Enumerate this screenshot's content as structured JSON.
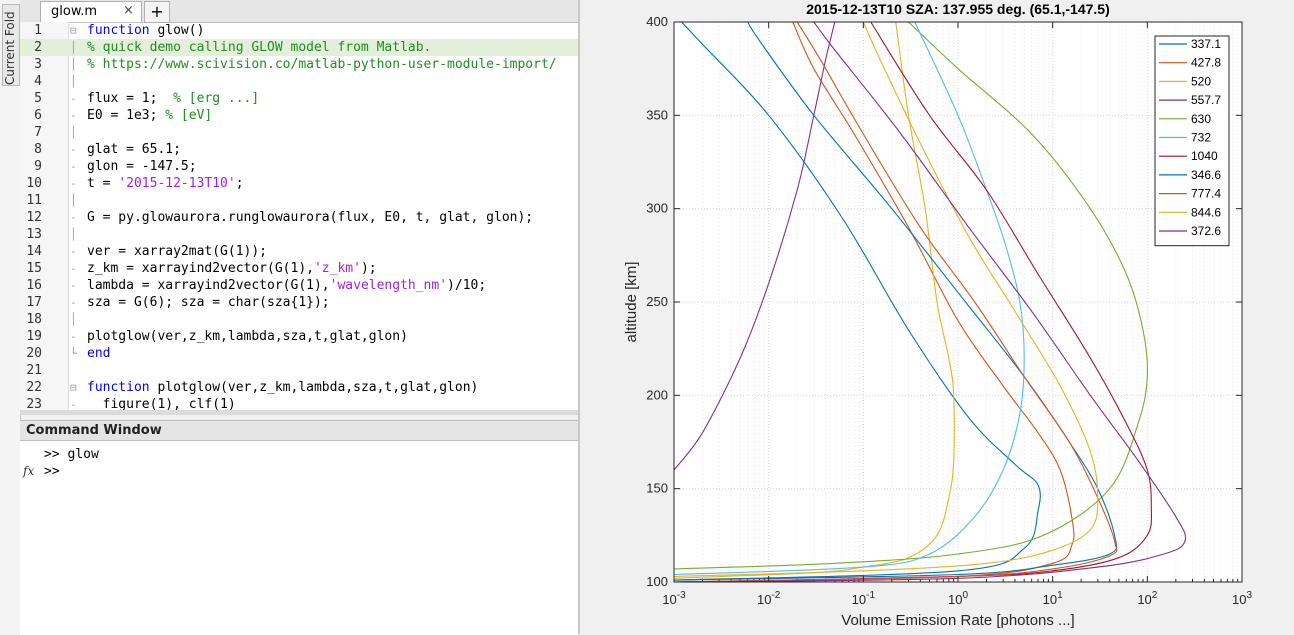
{
  "sidebar": {
    "current_folder_label": "Current Fold"
  },
  "editor": {
    "tabs": [
      {
        "label": "glow.m",
        "close": "×"
      }
    ],
    "add_tab": "+",
    "lines": [
      {
        "n": "1",
        "fold": "⊟",
        "segs": [
          {
            "t": "function",
            "c": "kw"
          },
          {
            "t": " glow()",
            "c": ""
          }
        ]
      },
      {
        "n": "2",
        "fold": "│",
        "hl": true,
        "segs": [
          {
            "t": "% quick demo calling GLOW model from Matlab.",
            "c": "cm"
          }
        ]
      },
      {
        "n": "3",
        "fold": "│",
        "segs": [
          {
            "t": "% https://www.scivision.co/matlab-python-user-module-import/",
            "c": "cm"
          }
        ]
      },
      {
        "n": "4",
        "fold": "│",
        "segs": []
      },
      {
        "n": "5",
        "fold": "-",
        "segs": [
          {
            "t": "flux = 1;  ",
            "c": ""
          },
          {
            "t": "% [erg ...]",
            "c": "cm"
          }
        ]
      },
      {
        "n": "6",
        "fold": "-",
        "segs": [
          {
            "t": "E0 = 1e3; ",
            "c": ""
          },
          {
            "t": "% [eV]",
            "c": "cm"
          }
        ]
      },
      {
        "n": "7",
        "fold": "│",
        "segs": []
      },
      {
        "n": "8",
        "fold": "-",
        "segs": [
          {
            "t": "glat = 65.1;",
            "c": ""
          }
        ]
      },
      {
        "n": "9",
        "fold": "-",
        "segs": [
          {
            "t": "glon = -147.5;",
            "c": ""
          }
        ]
      },
      {
        "n": "10",
        "fold": "-",
        "segs": [
          {
            "t": "t = ",
            "c": ""
          },
          {
            "t": "'2015-12-13T10'",
            "c": "str"
          },
          {
            "t": ";",
            "c": ""
          }
        ]
      },
      {
        "n": "11",
        "fold": "│",
        "segs": []
      },
      {
        "n": "12",
        "fold": "-",
        "segs": [
          {
            "t": "G = py.glowaurora.runglowaurora(flux, E0, t, glat, glon);",
            "c": ""
          }
        ]
      },
      {
        "n": "13",
        "fold": "│",
        "segs": []
      },
      {
        "n": "14",
        "fold": "-",
        "segs": [
          {
            "t": "ver = xarray2mat(G(1));",
            "c": ""
          }
        ]
      },
      {
        "n": "15",
        "fold": "-",
        "segs": [
          {
            "t": "z_km = xarrayind2vector(G(1),",
            "c": ""
          },
          {
            "t": "'z_km'",
            "c": "str"
          },
          {
            "t": ");",
            "c": ""
          }
        ]
      },
      {
        "n": "16",
        "fold": "-",
        "segs": [
          {
            "t": "lambda = xarrayind2vector(G(1),",
            "c": ""
          },
          {
            "t": "'wavelength_nm'",
            "c": "str"
          },
          {
            "t": ")/10;",
            "c": ""
          }
        ]
      },
      {
        "n": "17",
        "fold": "-",
        "segs": [
          {
            "t": "sza = G(6); sza = char(sza{1});",
            "c": ""
          }
        ]
      },
      {
        "n": "18",
        "fold": "│",
        "segs": []
      },
      {
        "n": "19",
        "fold": "-",
        "segs": [
          {
            "t": "plotglow(ver,z_km,lambda,sza,t,glat,glon)",
            "c": ""
          }
        ]
      },
      {
        "n": "20",
        "fold": "└",
        "segs": [
          {
            "t": "end",
            "c": "kw"
          }
        ]
      },
      {
        "n": "21",
        "fold": "",
        "segs": []
      },
      {
        "n": "22",
        "fold": "⊟",
        "segs": [
          {
            "t": "function",
            "c": "kw"
          },
          {
            "t": " plotglow(ver,z_km,lambda,sza,t,glat,glon)",
            "c": ""
          }
        ]
      },
      {
        "n": "23",
        "fold": "-",
        "segs": [
          {
            "t": "  figure(1), clf(1)",
            "c": ""
          }
        ]
      }
    ]
  },
  "command_window": {
    "title": "Command Window",
    "lines": [
      ">> glow",
      ">>"
    ],
    "fx_icon": "fx"
  },
  "chart_data": {
    "type": "line",
    "title": "2015-12-13T10 SZA: 137.955 deg.  (65.1,-147.5)",
    "xlabel": "Volume Emission Rate [photons ...]",
    "ylabel": "altitude [km]",
    "xscale": "log",
    "xlim": [
      0.001,
      1000
    ],
    "ylim": [
      100,
      400
    ],
    "xticks": [
      {
        "base": "10",
        "exp": "-3"
      },
      {
        "base": "10",
        "exp": "-2"
      },
      {
        "base": "10",
        "exp": "-1"
      },
      {
        "base": "10",
        "exp": "0"
      },
      {
        "base": "10",
        "exp": "1"
      },
      {
        "base": "10",
        "exp": "2"
      },
      {
        "base": "10",
        "exp": "3"
      }
    ],
    "yticks": [
      "100",
      "150",
      "200",
      "250",
      "300",
      "350",
      "400"
    ],
    "grid": true,
    "legend_position": "top-right",
    "series": [
      {
        "name": "337.1",
        "color": "#0072bd",
        "points": [
          [
            0.001,
            101
          ],
          [
            1,
            106
          ],
          [
            5,
            118
          ],
          [
            7,
            138
          ],
          [
            7,
            152
          ],
          [
            4,
            163
          ],
          [
            1.3,
            188
          ],
          [
            0.3,
            235
          ],
          [
            0.06,
            295
          ],
          [
            0.01,
            350
          ],
          [
            0.002,
            388
          ],
          [
            0.0012,
            400
          ]
        ]
      },
      {
        "name": "427.8",
        "color": "#d95319",
        "points": [
          [
            0.001,
            100
          ],
          [
            1,
            103
          ],
          [
            10,
            110
          ],
          [
            16,
            120
          ],
          [
            16,
            134
          ],
          [
            12,
            160
          ],
          [
            7,
            180
          ],
          [
            3,
            205
          ],
          [
            1,
            240
          ],
          [
            0.3,
            290
          ],
          [
            0.08,
            340
          ],
          [
            0.03,
            375
          ],
          [
            0.018,
            400
          ]
        ]
      },
      {
        "name": "520",
        "color": "#edb120",
        "points": [
          [
            0.001,
            102
          ],
          [
            0.03,
            105
          ],
          [
            0.1,
            108
          ],
          [
            0.3,
            113
          ],
          [
            0.6,
            125
          ],
          [
            0.8,
            145
          ],
          [
            0.9,
            165
          ],
          [
            0.9,
            200
          ],
          [
            0.8,
            220
          ],
          [
            0.6,
            250
          ],
          [
            0.45,
            300
          ],
          [
            0.3,
            350
          ],
          [
            0.22,
            400
          ]
        ]
      },
      {
        "name": "557.7",
        "color": "#7e2f8e",
        "points": [
          [
            0.001,
            160
          ],
          [
            0.002,
            180
          ],
          [
            0.005,
            220
          ],
          [
            0.01,
            260
          ],
          [
            0.02,
            310
          ],
          [
            0.03,
            350
          ],
          [
            0.04,
            380
          ],
          [
            0.05,
            400
          ]
        ]
      },
      {
        "name": "630",
        "color": "#77ac30",
        "points": [
          [
            0.001,
            107
          ],
          [
            0.05,
            110
          ],
          [
            1,
            115
          ],
          [
            8,
            125
          ],
          [
            40,
            150
          ],
          [
            80,
            185
          ],
          [
            100,
            210
          ],
          [
            90,
            235
          ],
          [
            60,
            265
          ],
          [
            25,
            300
          ],
          [
            6,
            340
          ],
          [
            1,
            375
          ],
          [
            0.3,
            400
          ]
        ]
      },
      {
        "name": "732",
        "color": "#4dbeee",
        "points": [
          [
            0.001,
            104
          ],
          [
            0.1,
            108
          ],
          [
            0.5,
            115
          ],
          [
            1.5,
            135
          ],
          [
            3,
            160
          ],
          [
            4.5,
            190
          ],
          [
            5,
            220
          ],
          [
            4.5,
            250
          ],
          [
            3.2,
            280
          ],
          [
            2,
            310
          ],
          [
            1,
            350
          ],
          [
            0.35,
            400
          ]
        ]
      },
      {
        "name": "1040",
        "color": "#a2142f",
        "points": [
          [
            0.001,
            100
          ],
          [
            1,
            103
          ],
          [
            10,
            106
          ],
          [
            50,
            113
          ],
          [
            100,
            125
          ],
          [
            110,
            140
          ],
          [
            100,
            160
          ],
          [
            60,
            185
          ],
          [
            25,
            220
          ],
          [
            7,
            265
          ],
          [
            2,
            310
          ],
          [
            0.5,
            350
          ],
          [
            0.12,
            400
          ]
        ]
      },
      {
        "name": "346.6",
        "color": "#0072bd",
        "points": [
          [
            0.001,
            101
          ],
          [
            1,
            104
          ],
          [
            10,
            109
          ],
          [
            40,
            115
          ],
          [
            45,
            125
          ],
          [
            30,
            150
          ],
          [
            15,
            175
          ],
          [
            5,
            210
          ],
          [
            1.2,
            250
          ],
          [
            0.2,
            300
          ],
          [
            0.03,
            350
          ],
          [
            0.008,
            390
          ],
          [
            0.006,
            400
          ]
        ]
      },
      {
        "name": "777.4",
        "color": "#d95319",
        "points": [
          [
            0.001,
            100
          ],
          [
            1,
            103
          ],
          [
            10,
            107
          ],
          [
            40,
            114
          ],
          [
            45,
            122
          ],
          [
            30,
            145
          ],
          [
            15,
            175
          ],
          [
            5,
            210
          ],
          [
            1.5,
            250
          ],
          [
            0.4,
            290
          ],
          [
            0.1,
            340
          ],
          [
            0.035,
            380
          ],
          [
            0.02,
            400
          ]
        ]
      },
      {
        "name": "844.6",
        "color": "#edb120",
        "points": [
          [
            0.001,
            103
          ],
          [
            0.1,
            106
          ],
          [
            2,
            110
          ],
          [
            10,
            117
          ],
          [
            25,
            128
          ],
          [
            30,
            145
          ],
          [
            25,
            170
          ],
          [
            12,
            205
          ],
          [
            4,
            245
          ],
          [
            1.3,
            285
          ],
          [
            0.4,
            335
          ],
          [
            0.15,
            380
          ],
          [
            0.1,
            400
          ]
        ]
      },
      {
        "name": "372.6",
        "color": "#7e2f8e",
        "points": [
          [
            0.001,
            100
          ],
          [
            1,
            102
          ],
          [
            30,
            108
          ],
          [
            150,
            115
          ],
          [
            250,
            122
          ],
          [
            200,
            135
          ],
          [
            80,
            165
          ],
          [
            25,
            200
          ],
          [
            6,
            245
          ],
          [
            1.3,
            290
          ],
          [
            0.25,
            340
          ],
          [
            0.05,
            385
          ],
          [
            0.03,
            400
          ]
        ]
      }
    ]
  }
}
